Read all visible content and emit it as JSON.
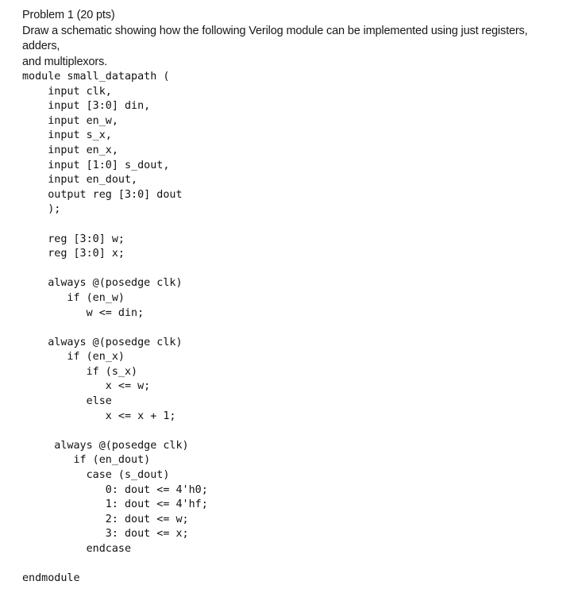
{
  "document": {
    "problem_heading": "Problem 1 (20 pts)",
    "instruction_line_1": "Draw a schematic showing how the following Verilog module can be implemented using just registers, adders,",
    "instruction_line_2": "and multiplexors.",
    "code_language": "verilog",
    "code": "module small_datapath (\n    input clk,\n    input [3:0] din,\n    input en_w,\n    input s_x,\n    input en_x,\n    input [1:0] s_dout,\n    input en_dout,\n    output reg [3:0] dout\n    );\n\n    reg [3:0] w;\n    reg [3:0] x;\n\n    always @(posedge clk)\n       if (en_w)\n          w <= din;\n\n    always @(posedge clk)\n       if (en_x)\n          if (s_x)\n             x <= w;\n          else\n             x <= x + 1;\n\n     always @(posedge clk)\n        if (en_dout)\n          case (s_dout)\n             0: dout <= 4'h0;\n             1: dout <= 4'hf;\n             2: dout <= w;\n             3: dout <= x;\n          endcase\n\nendmodule",
    "code_lines": [
      "module small_datapath (",
      "    input clk,",
      "    input [3:0] din,",
      "    input en_w,",
      "    input s_x,",
      "    input en_x,",
      "    input [1:0] s_dout,",
      "    input en_dout,",
      "    output reg [3:0] dout",
      "    );",
      "",
      "    reg [3:0] w;",
      "    reg [3:0] x;",
      "",
      "    always @(posedge clk)",
      "       if (en_w)",
      "          w <= din;",
      "",
      "    always @(posedge clk)",
      "       if (en_x)",
      "          if (s_x)",
      "             x <= w;",
      "          else",
      "             x <= x + 1;",
      "",
      "     always @(posedge clk)",
      "        if (en_dout)",
      "          case (s_dout)",
      "             0: dout <= 4'h0;",
      "             1: dout <= 4'hf;",
      "             2: dout <= w;",
      "             3: dout <= x;",
      "          endcase",
      "",
      "endmodule"
    ],
    "module_name": "small_datapath",
    "ports": [
      {
        "direction": "input",
        "width": "",
        "name": "clk"
      },
      {
        "direction": "input",
        "width": "[3:0]",
        "name": "din"
      },
      {
        "direction": "input",
        "width": "",
        "name": "en_w"
      },
      {
        "direction": "input",
        "width": "",
        "name": "s_x"
      },
      {
        "direction": "input",
        "width": "",
        "name": "en_x"
      },
      {
        "direction": "input",
        "width": "[1:0]",
        "name": "s_dout"
      },
      {
        "direction": "input",
        "width": "",
        "name": "en_dout"
      },
      {
        "direction": "output reg",
        "width": "[3:0]",
        "name": "dout"
      }
    ],
    "registers": [
      {
        "width": "[3:0]",
        "name": "w"
      },
      {
        "width": "[3:0]",
        "name": "x"
      }
    ],
    "case_items": [
      {
        "value": "0",
        "assignment": "dout <= 4'h0;"
      },
      {
        "value": "1",
        "assignment": "dout <= 4'hf;"
      },
      {
        "value": "2",
        "assignment": "dout <= w;"
      },
      {
        "value": "3",
        "assignment": "dout <= x;"
      }
    ]
  },
  "colors": {
    "background": "#ffffff",
    "text": "#181818",
    "code_text": "#111111"
  }
}
